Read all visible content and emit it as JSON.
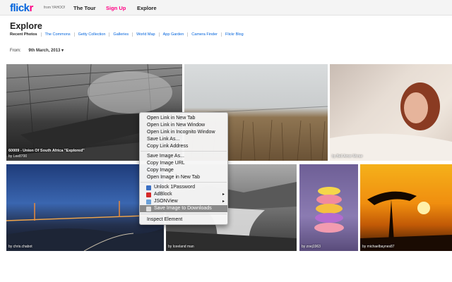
{
  "header": {
    "logo_flickr_blue": "flick",
    "logo_flickr_pink": "r",
    "logo_from": "from YAHOO!",
    "nav": [
      "The Tour",
      "Sign Up",
      "Explore"
    ]
  },
  "page": {
    "title": "Explore",
    "subnav": [
      "Recent Photos",
      "The Commons",
      "Getty Collection",
      "Galleries",
      "World Map",
      "App Garden",
      "Camera Finder",
      "Flickr Blog"
    ],
    "from_label": "From:",
    "date": "9th March, 2013"
  },
  "photos": [
    {
      "title": "60009 - Union Of South Africa \"Explored\"",
      "by": "by Lee8700"
    },
    {
      "title": "",
      "by": ""
    },
    {
      "title": "",
      "by": "by Bell Amor Mcrae"
    },
    {
      "title": "",
      "by": "by chris.chabot"
    },
    {
      "title": "",
      "by": "by Iceeland man"
    },
    {
      "title": "",
      "by": "by zoej1963"
    },
    {
      "title": "",
      "by": "by michaelbaynes87"
    }
  ],
  "context_menu": {
    "items": [
      "Open Link in New Tab",
      "Open Link in New Window",
      "Open Link in Incognito Window",
      "Save Link As...",
      "Copy Link Address",
      "Save Image As...",
      "Copy Image URL",
      "Copy Image",
      "Open Image in New Tab",
      "Unlock 1Password",
      "AdBlock",
      "JSONView",
      "Save Image to Downloads",
      "Inspect Element"
    ],
    "submenu_arrow": "▸",
    "highlighted": "Save Image to Downloads"
  },
  "colors": {
    "brand_blue": "#0063dc",
    "brand_pink": "#ff0084",
    "menu_highlight": "#8a8a8a"
  }
}
